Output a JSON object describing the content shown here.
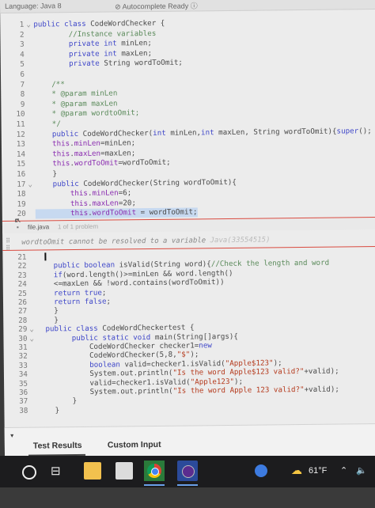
{
  "topbar": {
    "language": "Language: Java 8",
    "autocomplete": "Autocomplete Ready",
    "autocomplete_icon": "info-circle-icon"
  },
  "code_lines": [
    {
      "n": "1",
      "fold": "v",
      "segs": [
        [
          "kw",
          "public class "
        ],
        [
          "",
          "CodeWordChecker {"
        ]
      ]
    },
    {
      "n": "2",
      "segs": [
        [
          "cm",
          "        //Instance variables"
        ]
      ]
    },
    {
      "n": "3",
      "segs": [
        [
          "kw",
          "        private int "
        ],
        [
          "",
          "minLen;"
        ]
      ]
    },
    {
      "n": "4",
      "segs": [
        [
          "kw",
          "        private int "
        ],
        [
          "",
          "maxLen;"
        ]
      ]
    },
    {
      "n": "5",
      "segs": [
        [
          "kw",
          "        private "
        ],
        [
          "",
          "String wordToOmit;"
        ]
      ]
    },
    {
      "n": "6",
      "segs": []
    },
    {
      "n": "7",
      "segs": [
        [
          "cm",
          "    /**"
        ]
      ]
    },
    {
      "n": "8",
      "segs": [
        [
          "cm",
          "    * @param minLen"
        ]
      ]
    },
    {
      "n": "9",
      "segs": [
        [
          "cm",
          "    * @param maxLen"
        ]
      ]
    },
    {
      "n": "10",
      "segs": [
        [
          "cm",
          "    * @param wordtoOmit;"
        ]
      ]
    },
    {
      "n": "11",
      "segs": [
        [
          "cm",
          "    */"
        ]
      ]
    },
    {
      "n": "12",
      "segs": [
        [
          "kw",
          "    public "
        ],
        [
          "",
          "CodeWordChecker("
        ],
        [
          "kw",
          "int "
        ],
        [
          "",
          "minLen,"
        ],
        [
          "kw",
          "int "
        ],
        [
          "",
          "maxLen, String wordToOmit){"
        ],
        [
          "kw",
          "super"
        ],
        [
          "",
          "();"
        ]
      ]
    },
    {
      "n": "13",
      "segs": [
        [
          "fd",
          "    this"
        ],
        [
          "",
          "."
        ],
        [
          "fd",
          "minLen"
        ],
        [
          "",
          "=minLen;"
        ]
      ]
    },
    {
      "n": "14",
      "segs": [
        [
          "fd",
          "    this"
        ],
        [
          "",
          "."
        ],
        [
          "fd",
          "maxLen"
        ],
        [
          "",
          "=maxLen;"
        ]
      ]
    },
    {
      "n": "15",
      "segs": [
        [
          "fd",
          "    this"
        ],
        [
          "",
          "."
        ],
        [
          "fd",
          "wordToOmit"
        ],
        [
          "",
          "=wordToOmit;"
        ]
      ]
    },
    {
      "n": "16",
      "segs": [
        [
          "",
          "    }"
        ]
      ]
    },
    {
      "n": "17",
      "fold": "v",
      "segs": [
        [
          "kw",
          "    public "
        ],
        [
          "",
          "CodeWordChecker(String wordToOmit){"
        ]
      ]
    },
    {
      "n": "18",
      "segs": [
        [
          "fd",
          "        this"
        ],
        [
          "",
          "."
        ],
        [
          "fd",
          "minLen"
        ],
        [
          "",
          "=6;"
        ]
      ]
    },
    {
      "n": "19",
      "segs": [
        [
          "fd",
          "        this"
        ],
        [
          "",
          "."
        ],
        [
          "fd",
          "maxLen"
        ],
        [
          "",
          "=20;"
        ]
      ]
    },
    {
      "n": "20",
      "sel": true,
      "segs": [
        [
          "fd",
          "        this"
        ],
        [
          "",
          "."
        ],
        [
          "fd",
          "wordToOmit"
        ],
        [
          "",
          " = wordToOmit;"
        ]
      ]
    }
  ],
  "problems": {
    "file": "file.java",
    "count": "1 of 1 problem",
    "error_text": "wordtoOmit cannot be resolved to a variable",
    "error_tail": " Java(33554515)"
  },
  "code_lines2": [
    {
      "n": "21",
      "segs": []
    },
    {
      "n": "22",
      "segs": [
        [
          "kw",
          "    public boolean "
        ],
        [
          "",
          "isValid(String word){"
        ],
        [
          "cm",
          "//Check the length and word"
        ]
      ]
    },
    {
      "n": "23",
      "segs": [
        [
          "kw",
          "    if"
        ],
        [
          "",
          "(word.length()>=minLen && word.length()"
        ]
      ]
    },
    {
      "n": "24",
      "segs": [
        [
          "",
          "    <=maxLen && !word.contains(wordToOmit))"
        ]
      ]
    },
    {
      "n": "25",
      "segs": [
        [
          "kw",
          "    return true"
        ],
        [
          "",
          ";"
        ]
      ]
    },
    {
      "n": "26",
      "segs": [
        [
          "kw",
          "    return false"
        ],
        [
          "",
          ";"
        ]
      ]
    },
    {
      "n": "27",
      "segs": [
        [
          "",
          "    }"
        ]
      ]
    },
    {
      "n": "28",
      "segs": [
        [
          "",
          "    }"
        ]
      ]
    },
    {
      "n": "29",
      "fold": "v",
      "segs": [
        [
          "kw",
          "  public class "
        ],
        [
          "",
          "CodeWordCheckertest {"
        ]
      ]
    },
    {
      "n": "30",
      "fold": "v",
      "segs": [
        [
          "kw",
          "        public static void "
        ],
        [
          "",
          "main(String[]args){"
        ]
      ]
    },
    {
      "n": "31",
      "segs": [
        [
          "",
          "            CodeWordChecker checker1="
        ],
        [
          "kw",
          "new"
        ]
      ]
    },
    {
      "n": "32",
      "segs": [
        [
          "",
          "            CodeWordChecker(5,8,"
        ],
        [
          "str",
          "\"$\""
        ],
        [
          "",
          ");"
        ]
      ]
    },
    {
      "n": "33",
      "segs": [
        [
          "kw",
          "            boolean "
        ],
        [
          "",
          "valid=checker1.isValid("
        ],
        [
          "str",
          "\"Apple$123\""
        ],
        [
          "",
          ");"
        ]
      ]
    },
    {
      "n": "34",
      "segs": [
        [
          "",
          "            System.out.println("
        ],
        [
          "str",
          "\"Is the word Apple$123 valid?\""
        ],
        [
          "",
          "+valid);"
        ]
      ]
    },
    {
      "n": "35",
      "segs": [
        [
          "",
          "            valid=checker1.isValid("
        ],
        [
          "str",
          "\"Apple123\""
        ],
        [
          "",
          ");"
        ]
      ]
    },
    {
      "n": "36",
      "segs": [
        [
          "",
          "            System.out.println("
        ],
        [
          "str",
          "\"Is the word Apple 123 valid?\""
        ],
        [
          "",
          "+valid);"
        ]
      ]
    },
    {
      "n": "37",
      "segs": [
        [
          "",
          "        }"
        ]
      ]
    },
    {
      "n": "38",
      "segs": [
        [
          "",
          "    }"
        ]
      ]
    }
  ],
  "bottom_tabs": {
    "test_results": "Test Results",
    "custom_input": "Custom Input"
  },
  "taskbar": {
    "temperature": "61°F",
    "icons": [
      "search-icon",
      "task-view-icon",
      "file-explorer-icon",
      "store-icon",
      "chrome-icon",
      "eclipse-icon"
    ],
    "accent": "#6aa0e8"
  }
}
